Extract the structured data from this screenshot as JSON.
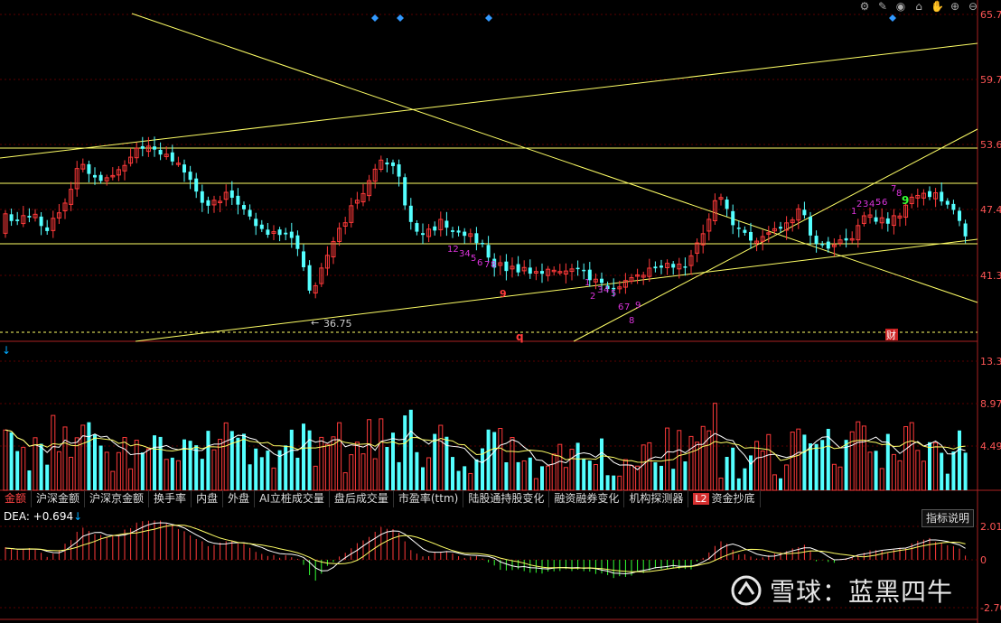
{
  "price_axis": {
    "labels": [
      "65.7",
      "59.7",
      "53.6",
      "47.4",
      "41.3"
    ]
  },
  "price_annotations": {
    "low_label": "36.75",
    "cai_badge": "财",
    "q_marker": "q",
    "nine_marker_left": "9",
    "nine_marker_right": "9"
  },
  "volume_axis": {
    "labels": [
      "13.3",
      "8.97",
      "4.49"
    ]
  },
  "macd_axis": {
    "labels": [
      "2.01",
      "0",
      "-2.70"
    ]
  },
  "tabs": [
    {
      "label": "金额",
      "active": true
    },
    {
      "label": "沪深金额",
      "active": false
    },
    {
      "label": "沪深京金额",
      "active": false
    },
    {
      "label": "换手率",
      "active": false
    },
    {
      "label": "内盘",
      "active": false
    },
    {
      "label": "外盘",
      "active": false
    },
    {
      "label": "AI立桩成交量",
      "active": false
    },
    {
      "label": "盘后成交量",
      "active": false
    },
    {
      "label": "市盈率(ttm)",
      "active": false
    },
    {
      "label": "陆股通持股变化",
      "active": false
    },
    {
      "label": "融资融券变化",
      "active": false
    },
    {
      "label": "机构探测器",
      "active": false
    },
    {
      "label": "资金抄底",
      "active": false,
      "badge": "L2"
    }
  ],
  "indicator_button": "指标说明",
  "macd_label": {
    "text": "DEA: +0.694",
    "arrow": "↓"
  },
  "volume_arrow": "↓",
  "watermark": {
    "text": "雪球：蓝黑四牛"
  },
  "toolbar_icons": [
    "settings-icon",
    "pen-icon",
    "eye-icon",
    "basket-icon",
    "hand-icon",
    "zoom-in-icon",
    "zoom-out-icon"
  ],
  "colors": {
    "up": "#ff3a3a",
    "down": "#54ffff",
    "line": "#ffff66",
    "grid": "#5a0000",
    "axis": "#aa2222"
  }
}
